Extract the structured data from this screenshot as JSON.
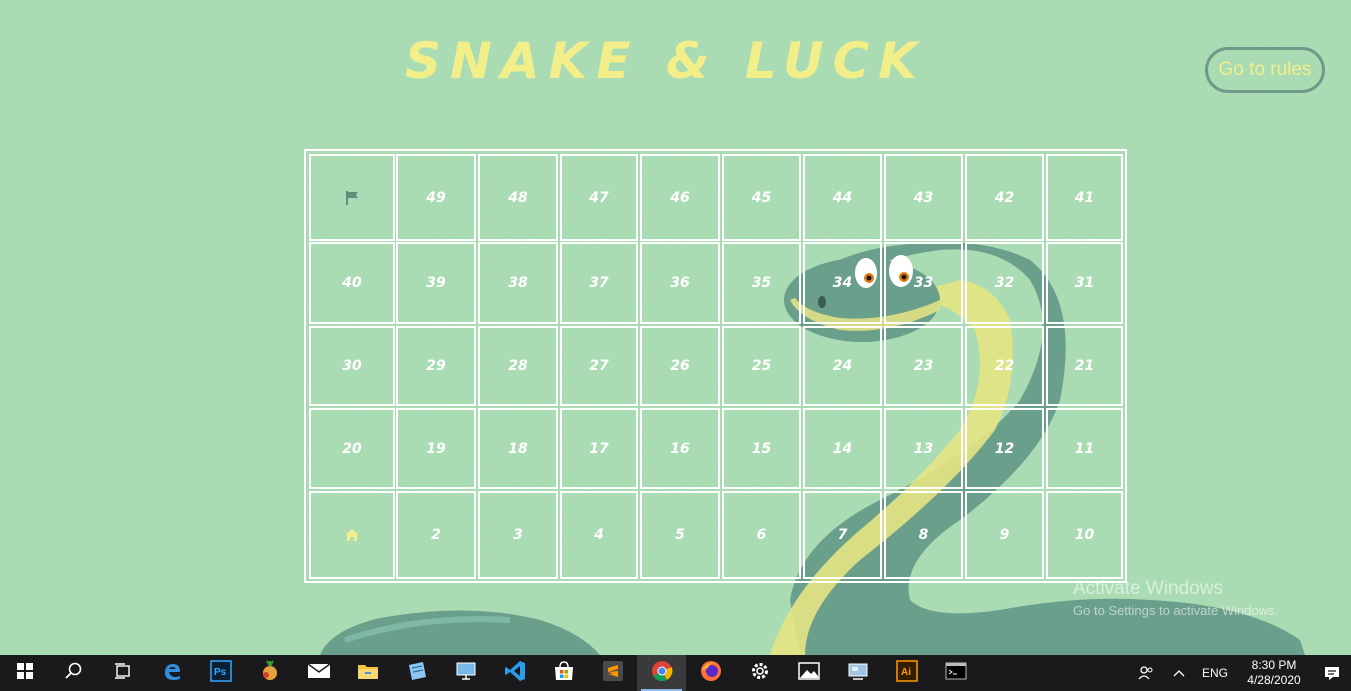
{
  "title": "SNAKE & LUCK",
  "rules_button": "Go to rules",
  "board": {
    "rows": [
      [
        "flag",
        "49",
        "48",
        "47",
        "46",
        "45",
        "44",
        "43",
        "42",
        "41"
      ],
      [
        "40",
        "39",
        "38",
        "37",
        "36",
        "35",
        "34",
        "33",
        "32",
        "31"
      ],
      [
        "30",
        "29",
        "28",
        "27",
        "26",
        "25",
        "24",
        "23",
        "22",
        "21"
      ],
      [
        "20",
        "19",
        "18",
        "17",
        "16",
        "15",
        "14",
        "13",
        "12",
        "11"
      ],
      [
        "home",
        "2",
        "3",
        "4",
        "5",
        "6",
        "7",
        "8",
        "9",
        "10"
      ]
    ],
    "flag_icon": "flag-icon",
    "home_icon": "home-icon"
  },
  "watermark": {
    "title": "Activate Windows",
    "subtitle": "Go to Settings to activate Windows."
  },
  "taskbar": {
    "apps": [
      {
        "name": "start-icon",
        "active": false
      },
      {
        "name": "search-icon",
        "active": false
      },
      {
        "name": "task-view-icon",
        "active": false
      },
      {
        "name": "edge-icon",
        "active": false
      },
      {
        "name": "photoshop-icon",
        "active": false
      },
      {
        "name": "fruit-app-icon",
        "active": false
      },
      {
        "name": "mail-icon",
        "active": false
      },
      {
        "name": "file-explorer-icon",
        "active": false
      },
      {
        "name": "notes-app-icon",
        "active": false
      },
      {
        "name": "remote-desktop-icon",
        "active": false
      },
      {
        "name": "vscode-icon",
        "active": false
      },
      {
        "name": "store-icon",
        "active": false
      },
      {
        "name": "sublime-text-icon",
        "active": false
      },
      {
        "name": "chrome-icon",
        "active": true
      },
      {
        "name": "firefox-icon",
        "active": false
      },
      {
        "name": "settings-icon",
        "active": false
      },
      {
        "name": "photos-icon",
        "active": false
      },
      {
        "name": "control-panel-icon",
        "active": false
      },
      {
        "name": "illustrator-icon",
        "active": false
      },
      {
        "name": "terminal-icon",
        "active": false
      }
    ],
    "language": "ENG",
    "time": "8:30 PM",
    "date": "4/28/2020"
  },
  "colors": {
    "background": "#a9dbb3",
    "title": "#f2ee8a",
    "snake_body": "#6a9f8b",
    "snake_belly": "#e6e484",
    "flag": "#5e8f7e",
    "home": "#f2ee8a"
  }
}
